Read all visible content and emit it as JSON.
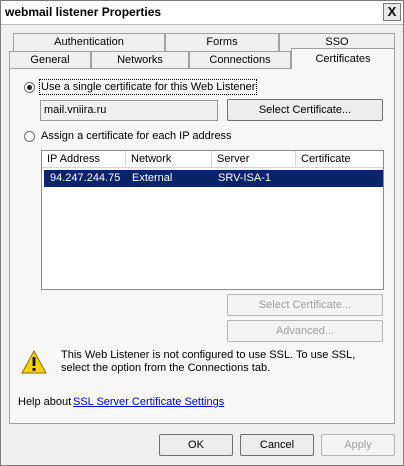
{
  "window": {
    "title": "webmail listener Properties",
    "close_glyph": "X"
  },
  "tabs_back": [
    {
      "label": "Authentication"
    },
    {
      "label": "Forms"
    },
    {
      "label": "SSO"
    }
  ],
  "tabs_front": [
    {
      "label": "General"
    },
    {
      "label": "Networks"
    },
    {
      "label": "Connections"
    },
    {
      "label": "Certificates"
    }
  ],
  "certificates": {
    "single_cert_option": "Use a single certificate for this Web Listener",
    "single_cert_value": "mail.vniira.ru",
    "select_certificate_label": "Select Certificate...",
    "per_ip_option": "Assign a certificate for each IP address",
    "table_columns": [
      "IP Address",
      "Network",
      "Server",
      "Certificate"
    ],
    "table_rows": [
      {
        "ip": "94.247.244.75",
        "network": "External",
        "server": "SRV-ISA-1",
        "certificate": ""
      }
    ],
    "select_certificate_disabled_label": "Select Certificate...",
    "advanced_label": "Advanced...",
    "warning_text": "This Web Listener is not configured to use SSL. To use SSL, select the option from the Connections tab.",
    "help_prefix": "Help about",
    "help_link": "SSL Server Certificate Settings"
  },
  "buttons": {
    "ok": "OK",
    "cancel": "Cancel",
    "apply": "Apply"
  },
  "icons": {
    "warning": "warning-icon",
    "close": "close-icon"
  },
  "colors": {
    "selection": "#0a246a",
    "link": "#0000cc",
    "warning": "#f5d200"
  }
}
